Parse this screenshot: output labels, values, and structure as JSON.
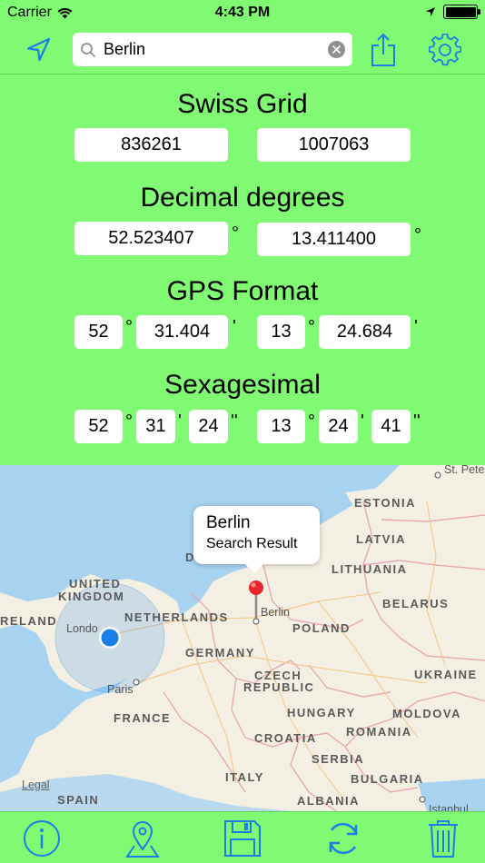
{
  "status": {
    "carrier": "Carrier",
    "time": "4:43 PM"
  },
  "search": {
    "value": "Berlin",
    "placeholder": ""
  },
  "sections": {
    "swiss": {
      "title": "Swiss Grid",
      "a": "836261",
      "b": "1007063"
    },
    "decimal": {
      "title": "Decimal degrees",
      "lat": "52.523407",
      "lon": "13.411400",
      "unit": "°"
    },
    "gps": {
      "title": "GPS Format",
      "lat_deg": "52",
      "lat_min": "31.404",
      "lon_deg": "13",
      "lon_min": "24.684",
      "deg_unit": "°",
      "min_unit": "'"
    },
    "sexa": {
      "title": "Sexagesimal",
      "lat_deg": "52",
      "lat_min": "31",
      "lat_sec": "24",
      "lon_deg": "13",
      "lon_min": "24",
      "lon_sec": "41",
      "deg_unit": "°",
      "min_unit": "'",
      "sec_unit": "''"
    }
  },
  "map": {
    "callout_title": "Berlin",
    "callout_subtitle": "Search Result",
    "pin_label": "Berlin",
    "legal": "Legal",
    "countries": {
      "estonia": "ESTONIA",
      "latvia": "LATVIA",
      "lithuania": "LITHUANIA",
      "belarus": "BELARUS",
      "uk1": "UNITED",
      "uk2": "KINGDOM",
      "ireland": "RELAND",
      "netherlands": "NETHERLANDS",
      "poland": "POLAND",
      "germany": "GERMANY",
      "czech1": "CZECH",
      "czech2": "REPUBLIC",
      "ukraine": "UKRAINE",
      "france": "FRANCE",
      "hungary": "HUNGARY",
      "moldova": "MOLDOVA",
      "romania": "ROMANIA",
      "croatia": "CROATIA",
      "serbia": "SERBIA",
      "italy": "ITALY",
      "bulgaria": "BULGARIA",
      "spain": "SPAIN",
      "albania": "ALBANIA",
      "d": "D"
    },
    "cities": {
      "london": "Londo",
      "paris": "Paris",
      "stpete": "St. Pete",
      "istanbul": "Istanbul"
    }
  },
  "colors": {
    "accent": "#1a7ee8",
    "background": "#80fa72",
    "pin": "#e8262b",
    "location": "#1a7ee8"
  }
}
